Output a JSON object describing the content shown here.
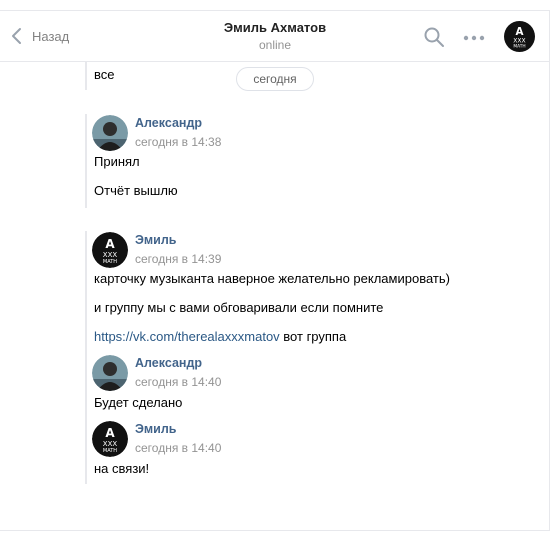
{
  "header": {
    "back_label": "Назад",
    "peer_name": "Эмиль Ахматов",
    "peer_status": "online",
    "search_icon": "search-icon",
    "more_icon": "more-icon"
  },
  "history": {
    "date_divider": "сегодня",
    "prev_message": "все",
    "messages": [
      {
        "author": "Александр",
        "time": "сегодня в 14:38",
        "lines": [
          "Принял",
          "Отчёт вышлю"
        ]
      },
      {
        "author": "Эмиль",
        "time": "сегодня в 14:39",
        "lines": [
          "карточку музыканта наверное желательно рекламировать)",
          "и группу мы с вами обговаривали если помните"
        ],
        "link": {
          "url": "https://vk.com/therealaxxxmatov",
          "suffix": " вот группа"
        }
      },
      {
        "author": "Александр",
        "time": "сегодня в 14:40",
        "lines": [
          "Будет сделано"
        ]
      },
      {
        "author": "Эмиль",
        "time": "сегодня в 14:40",
        "lines": [
          "на связи!"
        ]
      }
    ]
  },
  "colors": {
    "author_link": "#42648b",
    "url_link": "#2a5885",
    "muted": "#939393",
    "divider": "#e7e8ec"
  }
}
